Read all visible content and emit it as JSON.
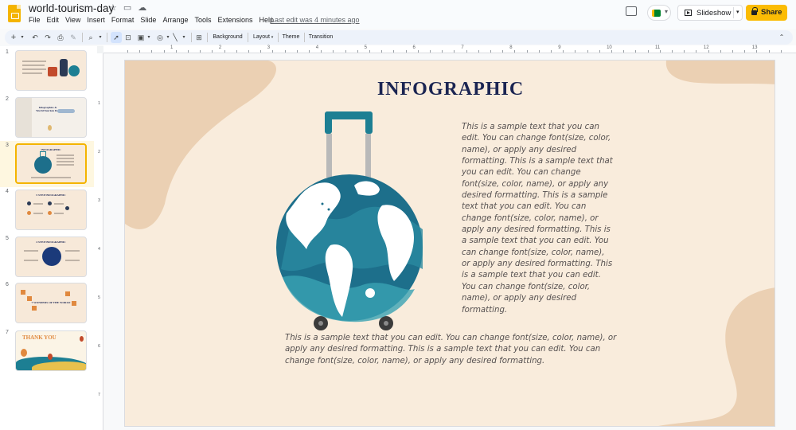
{
  "app": {
    "doc_title": "world-tourism-day",
    "menu": [
      "File",
      "Edit",
      "View",
      "Insert",
      "Format",
      "Slide",
      "Arrange",
      "Tools",
      "Extensions",
      "Help"
    ],
    "last_edit": "Last edit was 4 minutes ago",
    "slideshow_label": "Slideshow",
    "share_label": "Share"
  },
  "toolbar": {
    "background_label": "Background",
    "layout_label": "Layout",
    "theme_label": "Theme",
    "transition_label": "Transition"
  },
  "filmstrip": {
    "slides": [
      {
        "number": "1"
      },
      {
        "number": "2"
      },
      {
        "number": "3"
      },
      {
        "number": "4"
      },
      {
        "number": "5"
      },
      {
        "number": "6"
      },
      {
        "number": "7"
      }
    ],
    "selected": 3
  },
  "ruler": {
    "h_labels": [
      "1",
      "2",
      "3",
      "4",
      "5",
      "6",
      "7",
      "8",
      "9",
      "10",
      "11",
      "12",
      "13"
    ],
    "v_labels": [
      "1",
      "2",
      "3",
      "4",
      "5",
      "6",
      "7"
    ]
  },
  "slide": {
    "title": "INFOGRAPHIC",
    "right_text": "This is a sample text that you can edit. You can change font(size, color, name), or apply any desired formatting. This is a sample text that you can edit. You can change font(size, color, name), or apply any desired formatting. This is a sample text that you can edit. You can change font(size, color, name), or apply any desired formatting. This is a sample text that you can edit. You can change font(size, color, name), or apply any desired formatting. This is a sample text that you can edit. You can change font(size, color, name), or apply any desired formatting.",
    "bottom_text": "This is a sample text that you can edit. You can change font(size, color, name), or apply any desired formatting. This is a sample text that you can edit. You can change font(size, color, name), or apply any desired formatting.",
    "colors": {
      "background": "#f9ecdc",
      "blob": "#ebd0b3",
      "title": "#1b2552",
      "globe": "#1d6f8b",
      "handle": "#1d7f93"
    }
  },
  "thumbnails": {
    "t1": {
      "title": ""
    },
    "t2": {
      "title": "Infographics & World Tourism Day"
    },
    "t3": {
      "title": "INFOGRAPHIC"
    },
    "t4": {
      "title": "5 STEP INFOGRAPHIC"
    },
    "t5": {
      "title": "4 STEP INFOGRAPHIC"
    },
    "t6": {
      "title": "7 WONDERS OF THE WORLD"
    },
    "t7": {
      "title": "THANK YOU"
    }
  }
}
